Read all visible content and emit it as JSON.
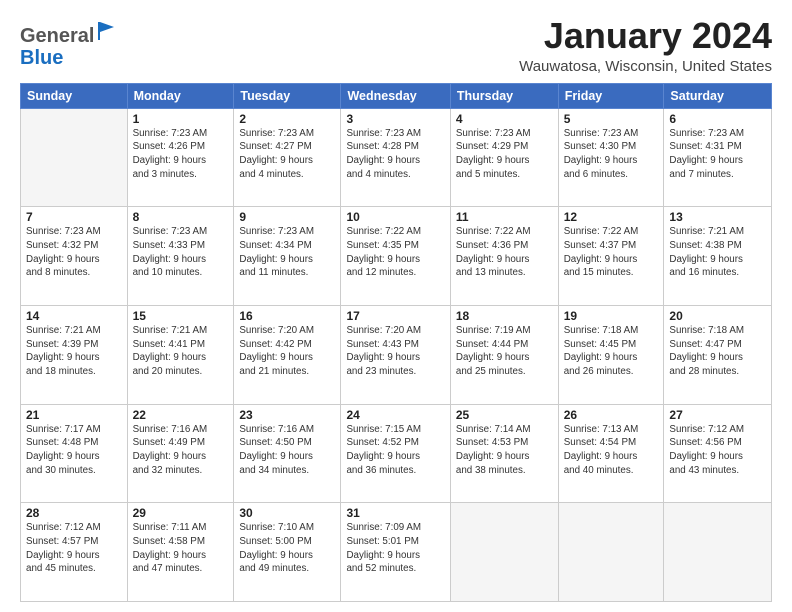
{
  "header": {
    "logo_general": "General",
    "logo_blue": "Blue",
    "month": "January 2024",
    "location": "Wauwatosa, Wisconsin, United States"
  },
  "days_of_week": [
    "Sunday",
    "Monday",
    "Tuesday",
    "Wednesday",
    "Thursday",
    "Friday",
    "Saturday"
  ],
  "weeks": [
    [
      {
        "day": "",
        "info": ""
      },
      {
        "day": "1",
        "info": "Sunrise: 7:23 AM\nSunset: 4:26 PM\nDaylight: 9 hours\nand 3 minutes."
      },
      {
        "day": "2",
        "info": "Sunrise: 7:23 AM\nSunset: 4:27 PM\nDaylight: 9 hours\nand 4 minutes."
      },
      {
        "day": "3",
        "info": "Sunrise: 7:23 AM\nSunset: 4:28 PM\nDaylight: 9 hours\nand 4 minutes."
      },
      {
        "day": "4",
        "info": "Sunrise: 7:23 AM\nSunset: 4:29 PM\nDaylight: 9 hours\nand 5 minutes."
      },
      {
        "day": "5",
        "info": "Sunrise: 7:23 AM\nSunset: 4:30 PM\nDaylight: 9 hours\nand 6 minutes."
      },
      {
        "day": "6",
        "info": "Sunrise: 7:23 AM\nSunset: 4:31 PM\nDaylight: 9 hours\nand 7 minutes."
      }
    ],
    [
      {
        "day": "7",
        "info": "Sunrise: 7:23 AM\nSunset: 4:32 PM\nDaylight: 9 hours\nand 8 minutes."
      },
      {
        "day": "8",
        "info": "Sunrise: 7:23 AM\nSunset: 4:33 PM\nDaylight: 9 hours\nand 10 minutes."
      },
      {
        "day": "9",
        "info": "Sunrise: 7:23 AM\nSunset: 4:34 PM\nDaylight: 9 hours\nand 11 minutes."
      },
      {
        "day": "10",
        "info": "Sunrise: 7:22 AM\nSunset: 4:35 PM\nDaylight: 9 hours\nand 12 minutes."
      },
      {
        "day": "11",
        "info": "Sunrise: 7:22 AM\nSunset: 4:36 PM\nDaylight: 9 hours\nand 13 minutes."
      },
      {
        "day": "12",
        "info": "Sunrise: 7:22 AM\nSunset: 4:37 PM\nDaylight: 9 hours\nand 15 minutes."
      },
      {
        "day": "13",
        "info": "Sunrise: 7:21 AM\nSunset: 4:38 PM\nDaylight: 9 hours\nand 16 minutes."
      }
    ],
    [
      {
        "day": "14",
        "info": "Sunrise: 7:21 AM\nSunset: 4:39 PM\nDaylight: 9 hours\nand 18 minutes."
      },
      {
        "day": "15",
        "info": "Sunrise: 7:21 AM\nSunset: 4:41 PM\nDaylight: 9 hours\nand 20 minutes."
      },
      {
        "day": "16",
        "info": "Sunrise: 7:20 AM\nSunset: 4:42 PM\nDaylight: 9 hours\nand 21 minutes."
      },
      {
        "day": "17",
        "info": "Sunrise: 7:20 AM\nSunset: 4:43 PM\nDaylight: 9 hours\nand 23 minutes."
      },
      {
        "day": "18",
        "info": "Sunrise: 7:19 AM\nSunset: 4:44 PM\nDaylight: 9 hours\nand 25 minutes."
      },
      {
        "day": "19",
        "info": "Sunrise: 7:18 AM\nSunset: 4:45 PM\nDaylight: 9 hours\nand 26 minutes."
      },
      {
        "day": "20",
        "info": "Sunrise: 7:18 AM\nSunset: 4:47 PM\nDaylight: 9 hours\nand 28 minutes."
      }
    ],
    [
      {
        "day": "21",
        "info": "Sunrise: 7:17 AM\nSunset: 4:48 PM\nDaylight: 9 hours\nand 30 minutes."
      },
      {
        "day": "22",
        "info": "Sunrise: 7:16 AM\nSunset: 4:49 PM\nDaylight: 9 hours\nand 32 minutes."
      },
      {
        "day": "23",
        "info": "Sunrise: 7:16 AM\nSunset: 4:50 PM\nDaylight: 9 hours\nand 34 minutes."
      },
      {
        "day": "24",
        "info": "Sunrise: 7:15 AM\nSunset: 4:52 PM\nDaylight: 9 hours\nand 36 minutes."
      },
      {
        "day": "25",
        "info": "Sunrise: 7:14 AM\nSunset: 4:53 PM\nDaylight: 9 hours\nand 38 minutes."
      },
      {
        "day": "26",
        "info": "Sunrise: 7:13 AM\nSunset: 4:54 PM\nDaylight: 9 hours\nand 40 minutes."
      },
      {
        "day": "27",
        "info": "Sunrise: 7:12 AM\nSunset: 4:56 PM\nDaylight: 9 hours\nand 43 minutes."
      }
    ],
    [
      {
        "day": "28",
        "info": "Sunrise: 7:12 AM\nSunset: 4:57 PM\nDaylight: 9 hours\nand 45 minutes."
      },
      {
        "day": "29",
        "info": "Sunrise: 7:11 AM\nSunset: 4:58 PM\nDaylight: 9 hours\nand 47 minutes."
      },
      {
        "day": "30",
        "info": "Sunrise: 7:10 AM\nSunset: 5:00 PM\nDaylight: 9 hours\nand 49 minutes."
      },
      {
        "day": "31",
        "info": "Sunrise: 7:09 AM\nSunset: 5:01 PM\nDaylight: 9 hours\nand 52 minutes."
      },
      {
        "day": "",
        "info": ""
      },
      {
        "day": "",
        "info": ""
      },
      {
        "day": "",
        "info": ""
      }
    ]
  ]
}
